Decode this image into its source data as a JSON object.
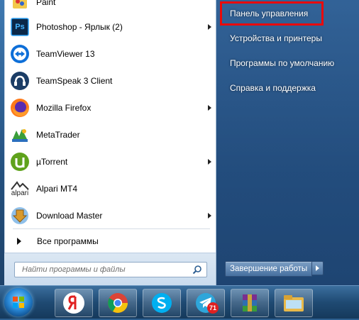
{
  "programs": [
    {
      "label": "Paint",
      "icon": "paint-icon",
      "submenu": false
    },
    {
      "label": "Photoshop - Ярлык (2)",
      "icon": "photoshop-icon",
      "submenu": true
    },
    {
      "label": "TeamViewer 13",
      "icon": "teamviewer-icon",
      "submenu": false
    },
    {
      "label": "TeamSpeak 3 Client",
      "icon": "teamspeak-icon",
      "submenu": false
    },
    {
      "label": "Mozilla Firefox",
      "icon": "firefox-icon",
      "submenu": true
    },
    {
      "label": "MetaTrader",
      "icon": "metatrader-icon",
      "submenu": false
    },
    {
      "label": "µTorrent",
      "icon": "utorrent-icon",
      "submenu": true
    },
    {
      "label": "Alpari MT4",
      "icon": "alpari-icon",
      "submenu": false
    },
    {
      "label": "Download Master",
      "icon": "download-master-icon",
      "submenu": true
    }
  ],
  "alpari_logo_text": "alpari",
  "ps_icon_text": "Ps",
  "all_programs_label": "Все программы",
  "search": {
    "placeholder": "Найти программы и файлы"
  },
  "right_pane": {
    "items": [
      {
        "label": "Панель управления",
        "highlighted": true
      },
      {
        "label": "Устройства и принтеры"
      },
      {
        "label": "Программы по умолчанию"
      },
      {
        "label": "Справка и поддержка"
      }
    ]
  },
  "shutdown_label": "Завершение работы",
  "taskbar": {
    "apps": [
      {
        "name": "yandex-browser-icon"
      },
      {
        "name": "chrome-icon"
      },
      {
        "name": "skype-icon"
      },
      {
        "name": "telegram-icon",
        "badge": "71"
      },
      {
        "name": "winrar-icon"
      },
      {
        "name": "file-explorer-icon"
      }
    ]
  },
  "colors": {
    "highlight_border": "#ea0a0a",
    "taskbar": "#1f4a73"
  }
}
